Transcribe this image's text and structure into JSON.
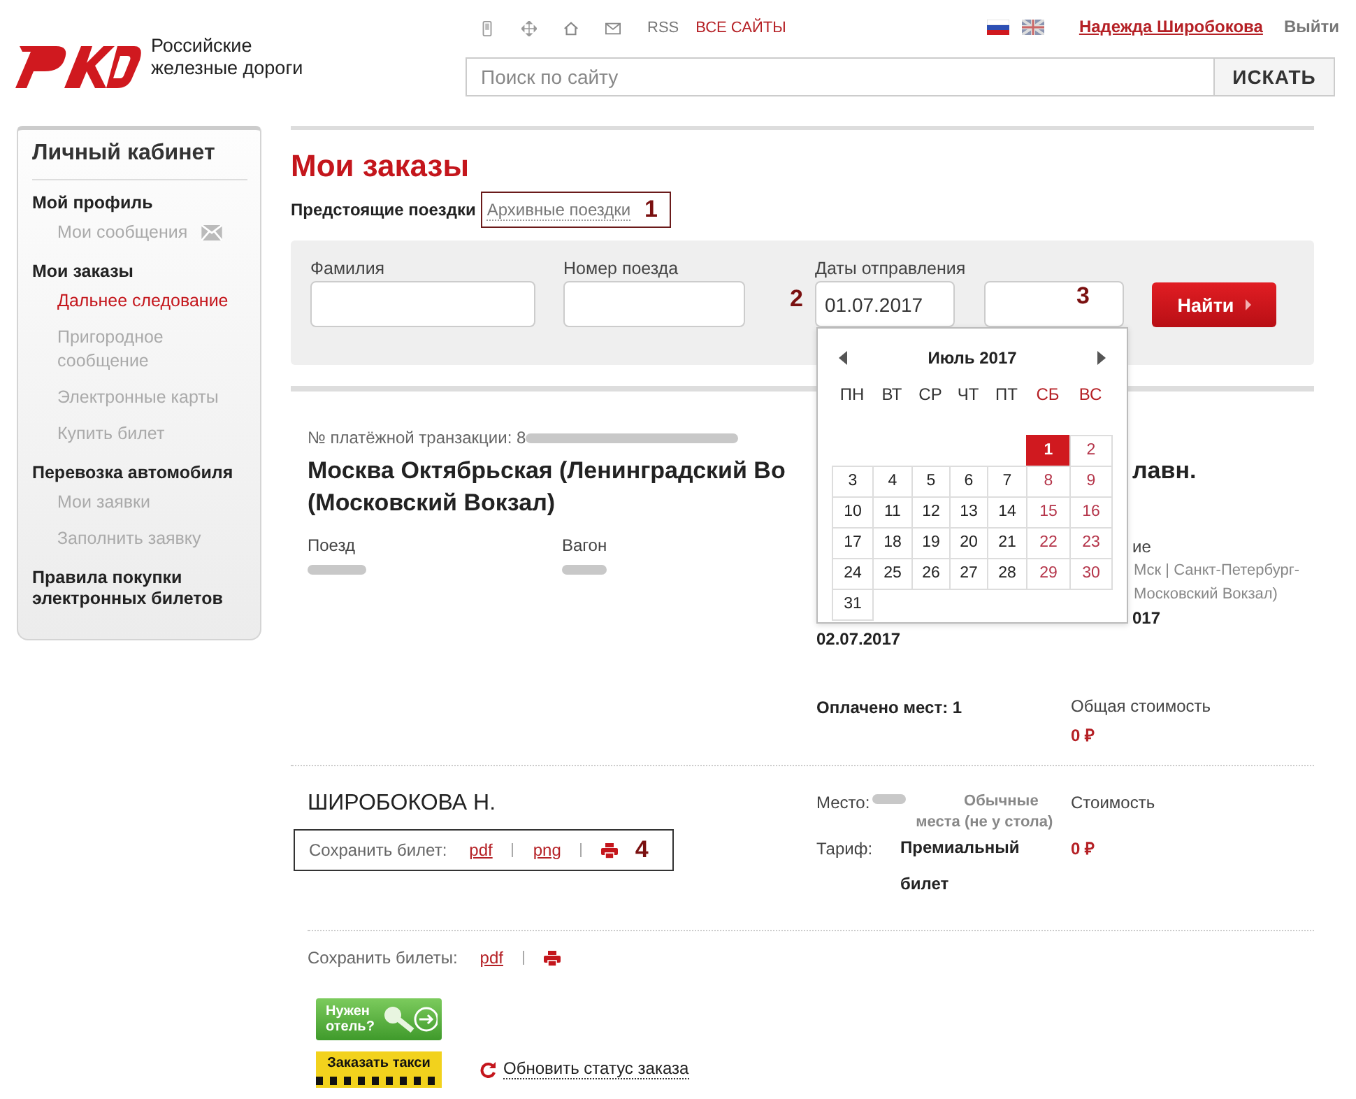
{
  "header": {
    "logo_text": [
      "Российские",
      "железные дороги"
    ],
    "top_links": [
      {
        "label": "RSS",
        "kind": "plain"
      },
      {
        "label": "ВСЕ САЙТЫ",
        "kind": "accent"
      }
    ],
    "user_name": "Надежда Широбокова",
    "logout": "Выйти",
    "search": {
      "placeholder": "Поиск по сайту",
      "button": "ИСКАТЬ"
    }
  },
  "sidebar": {
    "title": "Личный кабинет",
    "items": [
      {
        "label": "Мой профиль",
        "selected": false,
        "children": [
          {
            "label": "Мои сообщения",
            "kind": "messages",
            "selected": false
          }
        ]
      },
      {
        "label": "Мои заказы",
        "selected": false,
        "children": [
          {
            "label": "Дальнее следование",
            "selected": true
          },
          {
            "label": "Пригородное сообщение",
            "selected": false
          },
          {
            "label": "Электронные карты",
            "selected": false
          },
          {
            "label": "Купить билет",
            "selected": false
          }
        ]
      },
      {
        "label": "Перевозка автомобиля",
        "selected": false,
        "children": [
          {
            "label": "Мои заявки",
            "selected": false
          },
          {
            "label": "Заполнить заявку",
            "selected": false
          }
        ]
      },
      {
        "label": "Правила покупки электронных билетов",
        "selected": false
      }
    ]
  },
  "page_title": "Мои заказы",
  "tabs": [
    {
      "label": "Предстоящие поездки",
      "selected": true
    },
    {
      "label": "Архивные поездки",
      "selected": false,
      "annotation": "1"
    }
  ],
  "filters": {
    "surname_label": "Фамилия",
    "train_label": "Номер поезда",
    "dates_label": "Даты отправления",
    "date_from": {
      "value": "01.07.2017",
      "annotation": "2"
    },
    "date_to": {
      "annotation": "3"
    },
    "button": "Найти"
  },
  "calendar": {
    "month": "Июль 2017",
    "weekdays": [
      {
        "label": "ПН",
        "weekend": false
      },
      {
        "label": "ВТ",
        "weekend": false
      },
      {
        "label": "СР",
        "weekend": false
      },
      {
        "label": "ЧТ",
        "weekend": false
      },
      {
        "label": "ПТ",
        "weekend": false
      },
      {
        "label": "СБ",
        "weekend": true
      },
      {
        "label": "ВС",
        "weekend": true
      }
    ],
    "weeks": [
      [
        {
          "kind": "blank"
        },
        {
          "kind": "blank"
        },
        {
          "kind": "blank"
        },
        {
          "kind": "blank"
        },
        {
          "kind": "blank"
        },
        {
          "day": "1",
          "selected": true
        },
        {
          "day": "2",
          "selected": false
        }
      ],
      [
        {
          "day": "3",
          "selected": false
        },
        {
          "day": "4",
          "selected": false
        },
        {
          "day": "5",
          "selected": false
        },
        {
          "day": "6",
          "selected": false
        },
        {
          "day": "7",
          "selected": false
        },
        {
          "day": "8",
          "selected": false
        },
        {
          "day": "9",
          "selected": false
        }
      ],
      [
        {
          "day": "10",
          "selected": false
        },
        {
          "day": "11",
          "selected": false
        },
        {
          "day": "12",
          "selected": false
        },
        {
          "day": "13",
          "selected": false
        },
        {
          "day": "14",
          "selected": false
        },
        {
          "day": "15",
          "selected": false
        },
        {
          "day": "16",
          "selected": false
        }
      ],
      [
        {
          "day": "17",
          "selected": false
        },
        {
          "day": "18",
          "selected": false
        },
        {
          "day": "19",
          "selected": false
        },
        {
          "day": "20",
          "selected": false
        },
        {
          "day": "21",
          "selected": false
        },
        {
          "day": "22",
          "selected": false
        },
        {
          "day": "23",
          "selected": false
        }
      ],
      [
        {
          "day": "24",
          "selected": false
        },
        {
          "day": "25",
          "selected": false
        },
        {
          "day": "26",
          "selected": false
        },
        {
          "day": "27",
          "selected": false
        },
        {
          "day": "28",
          "selected": false
        },
        {
          "day": "29",
          "selected": false
        },
        {
          "day": "30",
          "selected": false
        }
      ],
      [
        {
          "day": "31",
          "selected": false
        },
        {
          "kind": "blank"
        },
        {
          "kind": "blank"
        },
        {
          "kind": "blank"
        },
        {
          "kind": "blank"
        },
        {
          "kind": "blank"
        },
        {
          "kind": "blank"
        }
      ]
    ]
  },
  "order": {
    "transaction_label": "№ платёжной транзакции: 8",
    "route_line1_left": "Москва Октябрьская (Ленинградский Во",
    "route_line1_right": "лавн.",
    "route_line2": "(Московский Вокзал)",
    "train_label": "Поезд",
    "car_label": "Вагон",
    "arrival_fragments": [
      "ие",
      "Мск | Санкт-Петербург-",
      "Московский Вокзал)",
      "017"
    ],
    "departure_date": "02.07.2017",
    "paid_seats": "Оплачено мест: 1",
    "total_label": "Общая стоимость",
    "total_value": "0 ₽"
  },
  "passenger": {
    "name": "ШИРОБОКОВА Н.",
    "save_label": "Сохранить билет:",
    "save_links": [
      "pdf",
      "png"
    ],
    "annotation": "4",
    "seat_label": "Место:",
    "seat_type": "Обычные места (не у стола)",
    "tariff_label": "Тариф:",
    "tariff": "Премиальный билет",
    "cost_label": "Стоимость",
    "cost_value": "0 ₽"
  },
  "save_all": {
    "label": "Сохранить билеты:",
    "links": [
      "pdf"
    ]
  },
  "banners": [
    {
      "kind": "hotel",
      "lines": [
        "Нужен",
        "отель?"
      ]
    },
    {
      "kind": "taxi",
      "lines": [
        "Заказать такси"
      ]
    }
  ],
  "refresh_link": "Обновить статус заказа"
}
